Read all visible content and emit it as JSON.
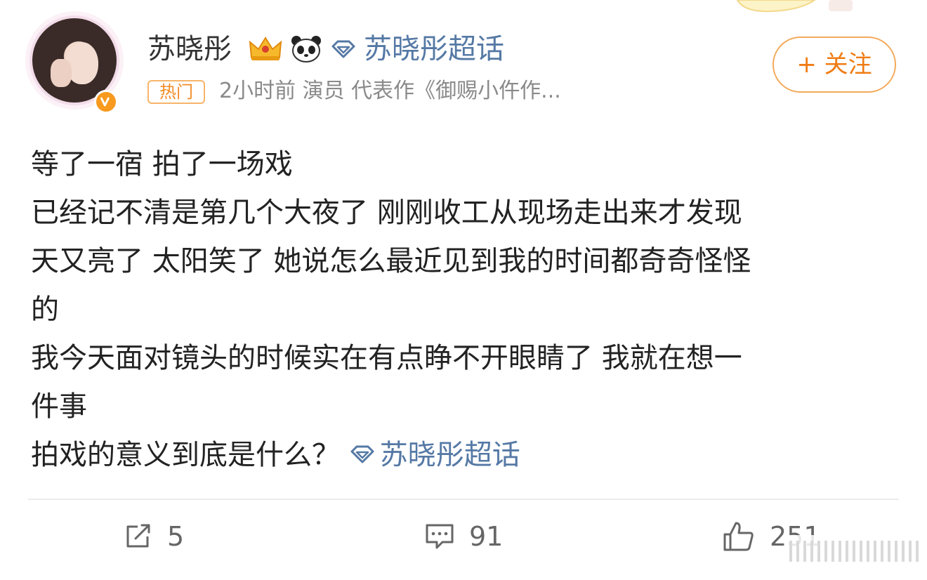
{
  "post": {
    "author": {
      "name": "苏晓彤",
      "avatar_icon": "avatar",
      "verified_icon": "verified-v-icon",
      "badges": [
        "crown-icon",
        "panda-icon"
      ],
      "supertopic_label": "苏晓彤超话"
    },
    "hot_badge": "热门",
    "meta": "2小时前  演员 代表作《御赐小仵作...",
    "follow_label": "+ 关注",
    "lines": [
      "等了一宿 拍了一场戏",
      "已经记不清是第几个大夜了 刚刚收工从现场走出来才发现",
      "天又亮了 太阳笑了 她说怎么最近见到我的时间都奇奇怪怪",
      "的",
      "我今天面对镜头的时候实在有点睁不开眼睛了 我就在想一",
      "件事",
      "拍戏的意义到底是什么？"
    ],
    "inline_topic": "苏晓彤超话"
  },
  "actions": {
    "repost_count": "5",
    "comment_count": "91",
    "like_count": "251"
  },
  "colors": {
    "accent_orange": "#f07c13",
    "link_blue": "#5579a5",
    "muted_gray": "#8a8a8a"
  }
}
